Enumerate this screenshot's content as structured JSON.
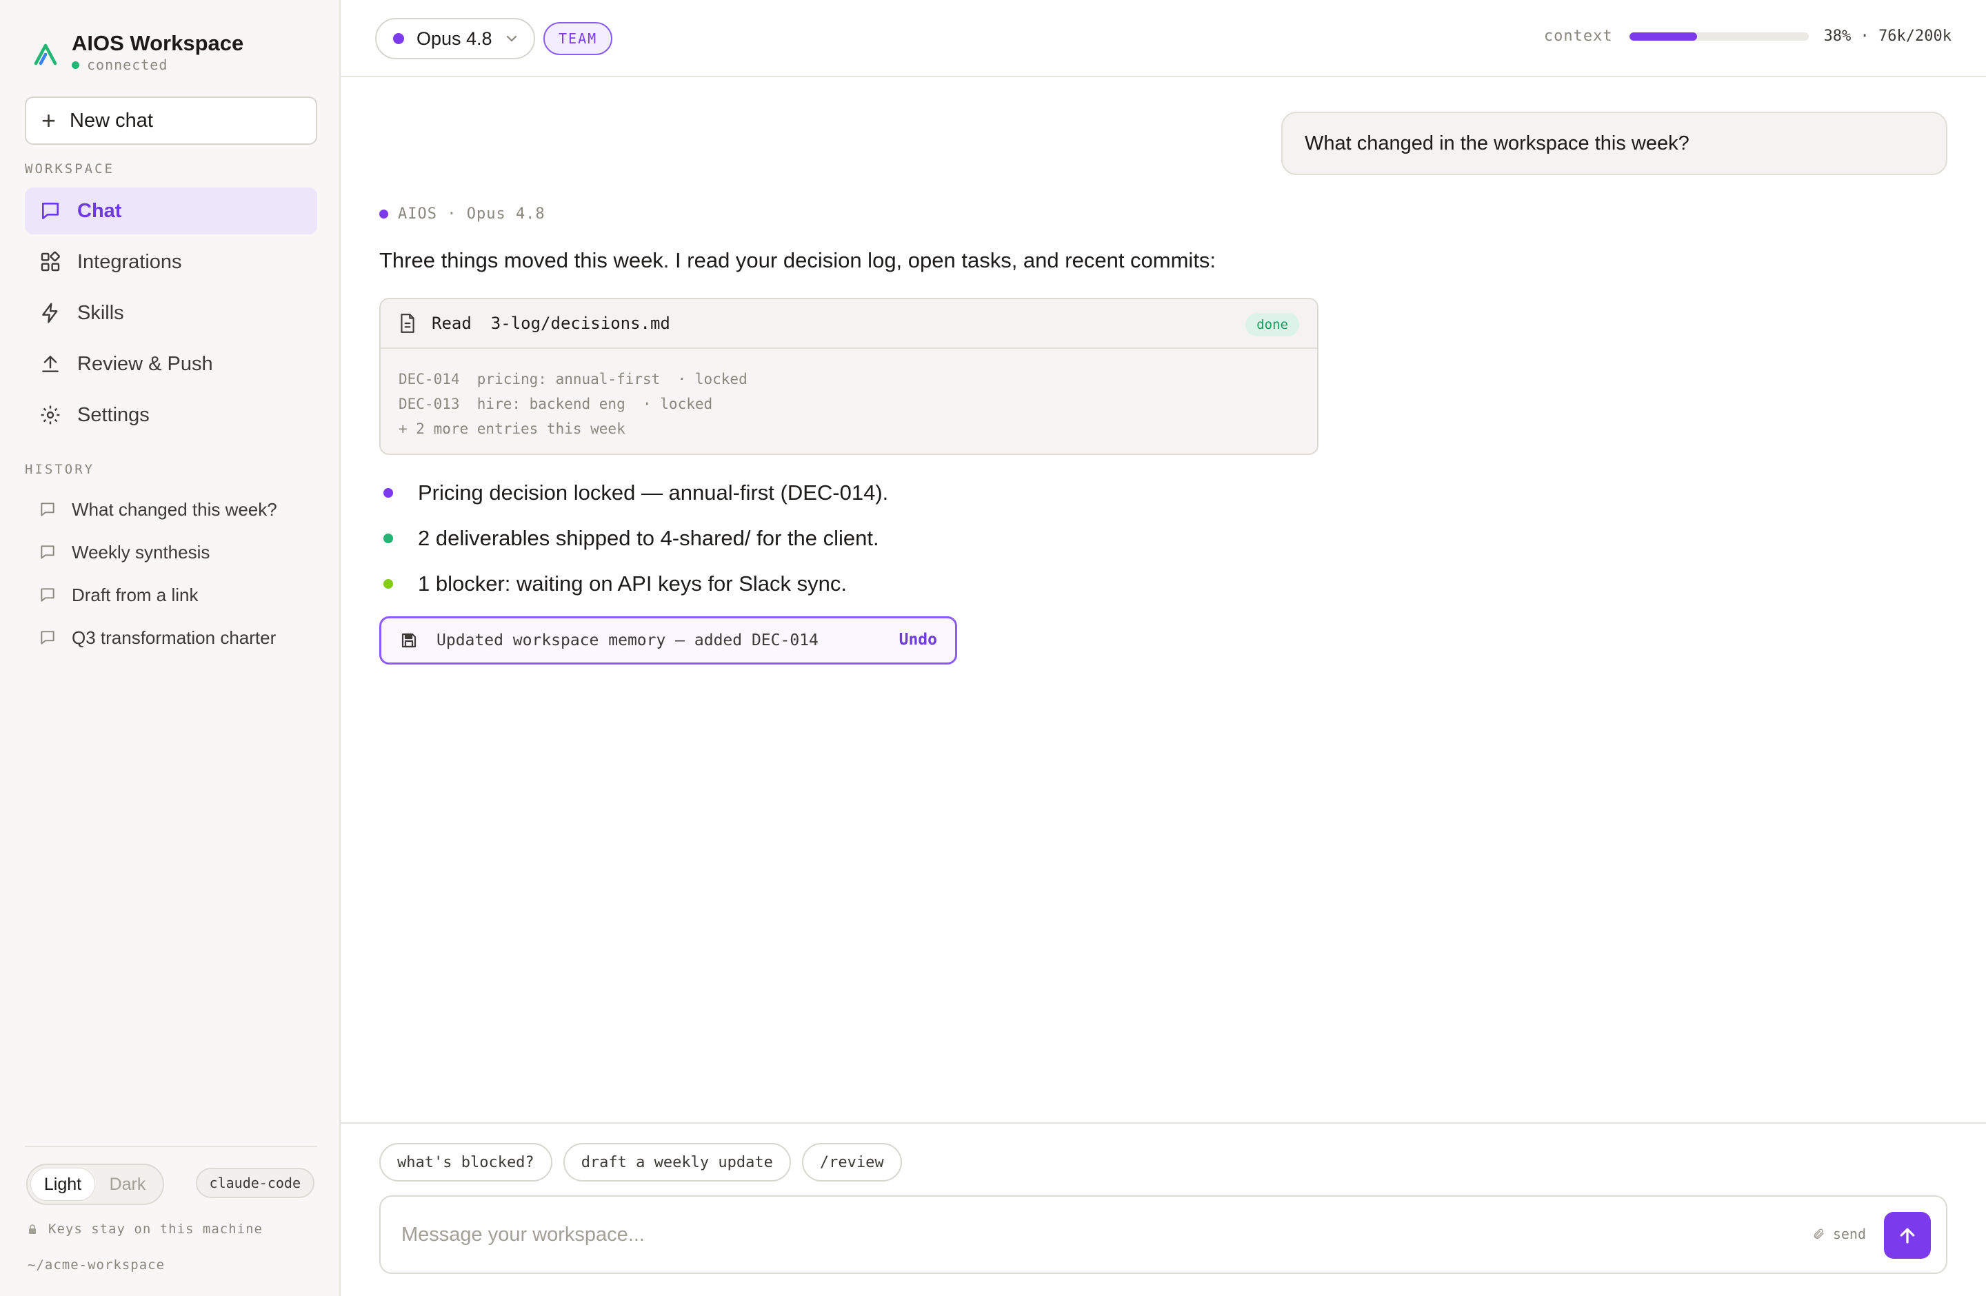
{
  "brand": {
    "title": "AIOS Workspace",
    "status": "connected"
  },
  "sidebar": {
    "new_chat_label": "New chat",
    "workspace_label": "WORKSPACE",
    "nav": [
      {
        "label": "Chat",
        "icon": "chat-bubble-icon",
        "active": true
      },
      {
        "label": "Integrations",
        "icon": "integrations-grid-icon"
      },
      {
        "label": "Skills",
        "icon": "lightning-bolt-icon"
      },
      {
        "label": "Review & Push",
        "icon": "upload-arrow-icon"
      },
      {
        "label": "Settings",
        "icon": "gear-icon"
      }
    ],
    "history_label": "HISTORY",
    "history": [
      {
        "label": "What changed this week?"
      },
      {
        "label": "Weekly synthesis"
      },
      {
        "label": "Draft from a link"
      },
      {
        "label": "Q3 transformation charter"
      }
    ],
    "footer": {
      "theme_light": "Light",
      "theme_dark": "Dark",
      "env_badge": "claude-code",
      "note": "Keys stay on this machine",
      "path": "~/acme-workspace"
    }
  },
  "topbar": {
    "model": "Opus 4.8",
    "plan_badge": "TEAM",
    "context_label": "context",
    "context_fraction": 0.38,
    "context_value": "38% · 76k/200k"
  },
  "conversation": {
    "user_message": "What changed in the workspace this week?",
    "assistant_meta": "AIOS · Opus 4.8",
    "assistant_intro": "Three things moved this week. I read your decision log, open tasks, and recent commits:",
    "tool": {
      "verb": "Read",
      "path": "3-log/decisions.md",
      "status": "done",
      "lines": [
        "DEC-014  pricing: annual-first  · locked",
        "DEC-013  hire: backend eng  · locked",
        "+ 2 more entries this week"
      ]
    },
    "bullets": [
      {
        "text": "Pricing decision locked — annual-first (DEC-014).",
        "color": "#7c3aed"
      },
      {
        "text": "2 deliverables shipped to 4-shared/ for the client.",
        "color": "#22b573"
      },
      {
        "text": "1 blocker: waiting on API keys for Slack sync.",
        "color": "#84cc16"
      }
    ],
    "memory": {
      "text": "Updated workspace memory — added DEC-014",
      "undo": "Undo"
    }
  },
  "composer": {
    "chips": [
      "what's blocked?",
      "draft a weekly update",
      "/review"
    ],
    "placeholder": "Message your workspace...",
    "send_hint": "send"
  },
  "colors": {
    "accent": "#7c3aed",
    "success": "#22b573"
  }
}
